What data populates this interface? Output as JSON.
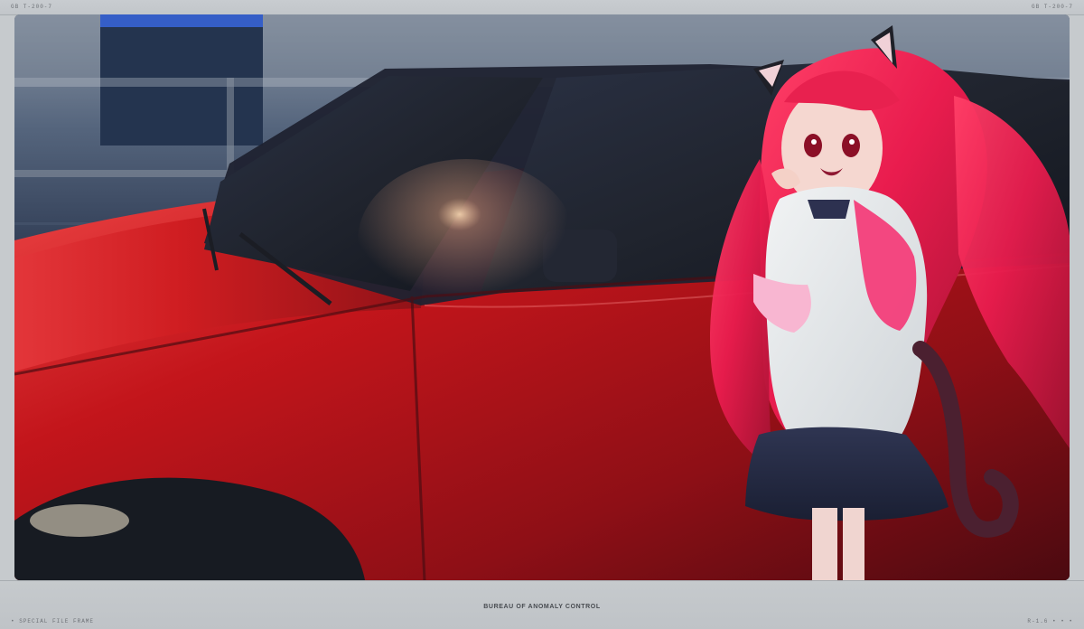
{
  "frame": {
    "top_left_code": "GB  T-200-7",
    "top_right_code": "GB  T-200-7",
    "bottom_title": "BUREAU OF ANOMALY CONTROL",
    "bottom_left_code": "• SPECIAL FILE FRAME",
    "bottom_right_code": "R-1.6 • • •"
  }
}
